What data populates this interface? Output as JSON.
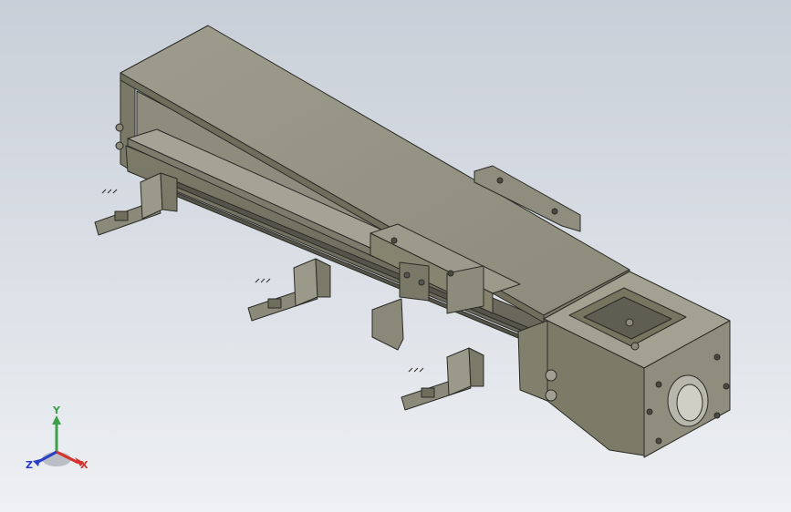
{
  "viewport": {
    "background_top": "#c9cfd8",
    "background_bottom": "#eef0f3"
  },
  "model": {
    "description_colors": {
      "body_light": "#9a998a",
      "body_mid": "#84836f",
      "body_dark": "#6a6958",
      "edge": "#2b2b26"
    }
  },
  "triad": {
    "y_label": "Y",
    "x_label": "X",
    "z_label": "Z",
    "x_color": "#d6312b",
    "y_color": "#3aa04a",
    "z_color": "#2b3fc6"
  }
}
